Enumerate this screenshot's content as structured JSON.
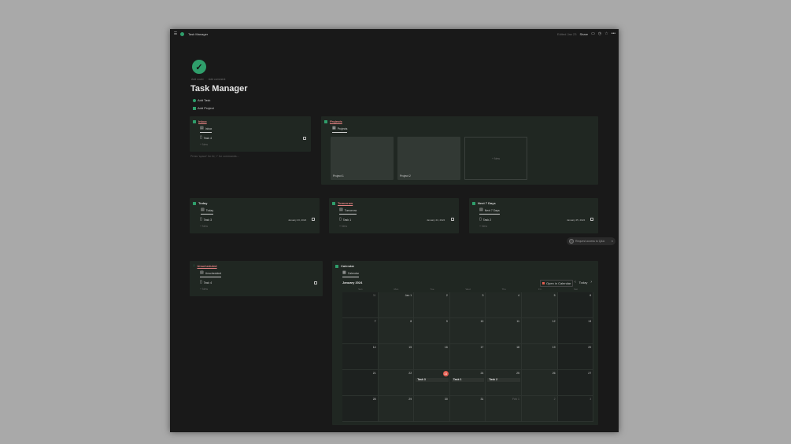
{
  "window": {
    "title": "Task Manager",
    "edited": "Edited Jan 23",
    "share": "Share"
  },
  "page": {
    "icon": "check-circle-icon",
    "meta_cover": "Add cover",
    "meta_comment": "Add comment",
    "title": "Task Manager",
    "add_task": "Add Task",
    "add_project": "Add Project",
    "placeholder": "Press 'space' for AI, '/' for commands…"
  },
  "inbox": {
    "title": "Inbox",
    "tab": "Inbox",
    "rows": [
      "Task 4"
    ],
    "new": "+ New"
  },
  "projects": {
    "title": "Projects",
    "tab": "Projects",
    "cards": [
      "Project 1",
      "Project 2"
    ],
    "new": "+ New"
  },
  "today": {
    "title": "Today",
    "tab": "Today",
    "task": "Task 3",
    "date": "January 23, 2024",
    "new": "+ New"
  },
  "tomorrow": {
    "title": "Tomorrow",
    "tab": "Tomorrow",
    "task": "Task 1",
    "date": "January 24, 2024",
    "new": "+ New"
  },
  "next7": {
    "title": "Next 7 Days",
    "tab": "Next 7 Days",
    "task": "Task 2",
    "date": "January 25, 2024",
    "new": "+ New"
  },
  "qa": {
    "label": "Request access to Q&A"
  },
  "unscheduled": {
    "title": "Unscheduled",
    "tab": "Unscheduled",
    "task": "Task 4",
    "new": "+ New"
  },
  "calendar": {
    "title": "Calendar",
    "tab": "Calendar",
    "month": "January 2024",
    "open_in": "Open in Calendar",
    "today_btn": "Today",
    "weekdays": [
      "Sun",
      "Mon",
      "Tue",
      "Wed",
      "Thu",
      "Fri",
      "Sat"
    ],
    "weeks": [
      [
        "31",
        "Jan 1",
        "2",
        "3",
        "4",
        "5",
        "6"
      ],
      [
        "7",
        "8",
        "9",
        "10",
        "11",
        "12",
        "13"
      ],
      [
        "14",
        "15",
        "16",
        "17",
        "18",
        "19",
        "20"
      ],
      [
        "21",
        "22",
        "23",
        "24",
        "25",
        "26",
        "27"
      ],
      [
        "28",
        "29",
        "30",
        "31",
        "Feb 1",
        "2",
        "3"
      ]
    ],
    "events": [
      "Task 3",
      "Task 1",
      "Task 2"
    ],
    "colors": {
      "today": "#e45d50",
      "accent": "#2f9e6b"
    }
  }
}
